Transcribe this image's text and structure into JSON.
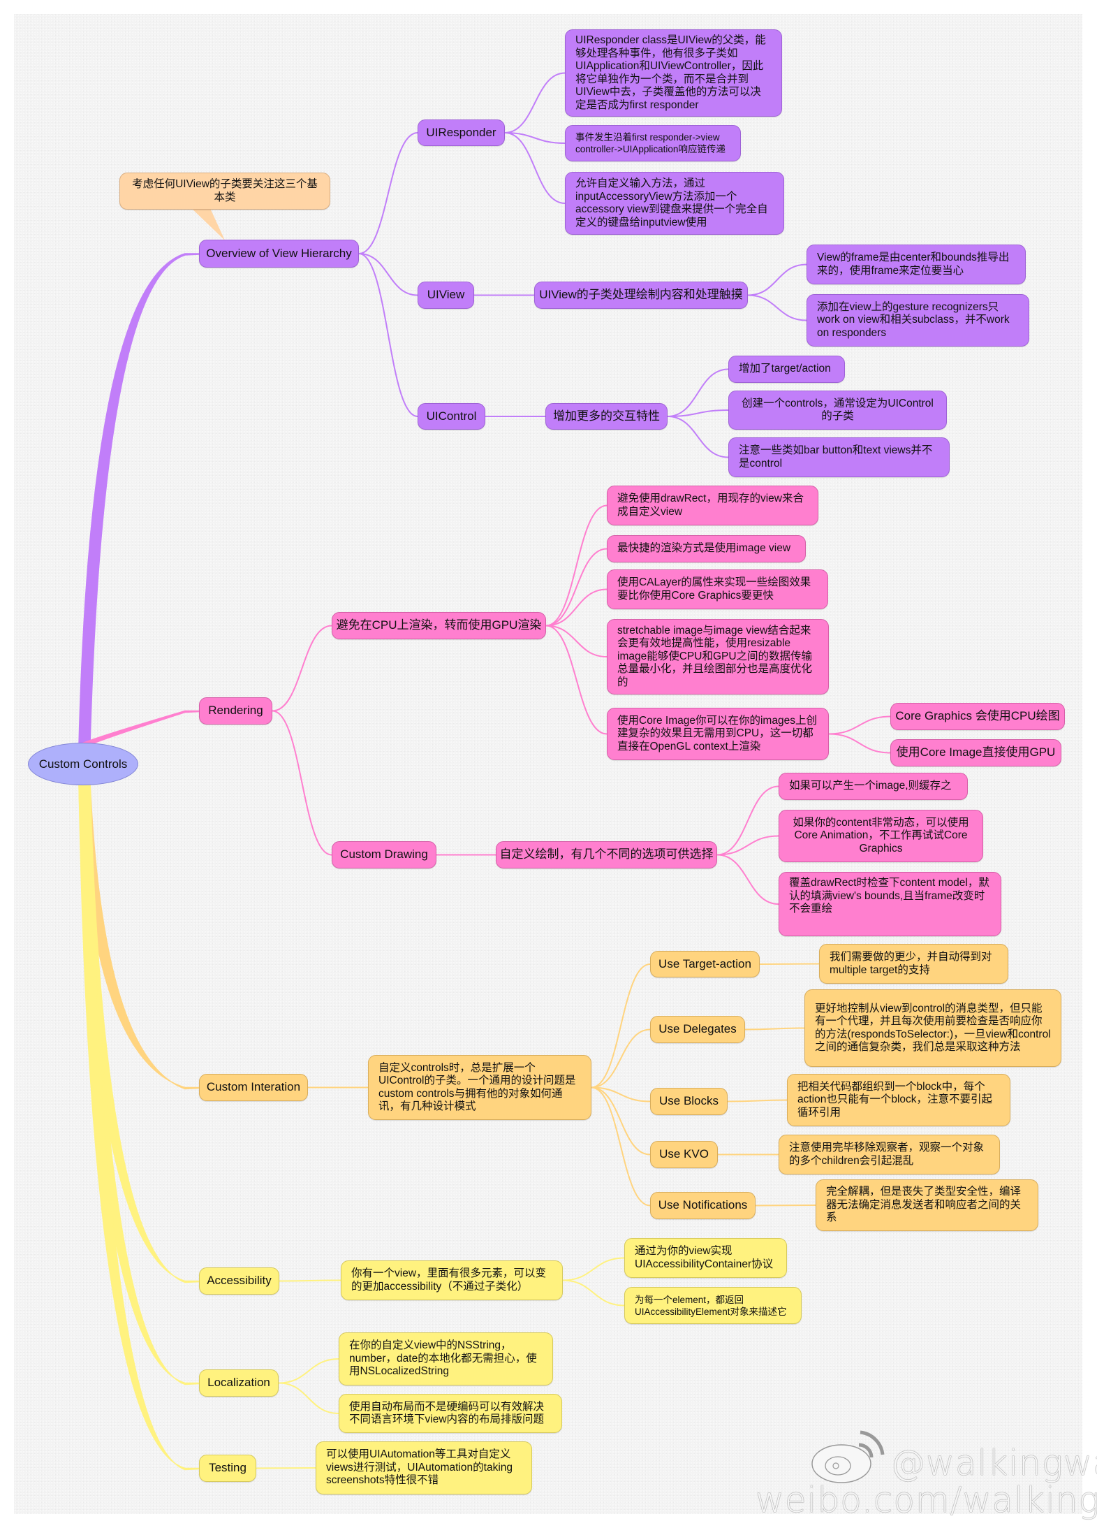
{
  "root": {
    "label": "Custom Controls"
  },
  "colors": {
    "view_hierarchy": "#c17ef9",
    "rendering": "#ff7fcf",
    "interaction": "#ffd47f",
    "accessibility_localization_testing": "#fff27f",
    "callout": "#ffd5a6",
    "root": "#aeb0fb"
  },
  "callout": {
    "text": "考虑任何UIView的子类要关注这三个基本类"
  },
  "branches": {
    "overview": {
      "label": "Overview of View Hierarchy",
      "uiresponder": {
        "label": "UIResponder",
        "notes": [
          "UIResponder class是UIView的父类，能够处理各种事件，他有很多子类如UIApplication和UIViewController，因此将它单独作为一个类，而不是合并到UIView中去，子类覆盖他的方法可以决定是否成为first responder",
          "事件发生沿着first responder->view controller->UIApplication响应链传递",
          "允许自定义输入方法，通过inputAccessoryView方法添加一个accessory view到键盘来提供一个完全自定义的键盘给inputview使用"
        ]
      },
      "uiview": {
        "label": "UIView",
        "desc": "UIView的子类处理绘制内容和处理触摸",
        "notes": [
          "View的frame是由center和bounds推导出来的，使用frame来定位要当心",
          "添加在view上的gesture recognizers只work on view和相关subclass，并不work on responders"
        ]
      },
      "uicontrol": {
        "label": "UIControl",
        "desc": "增加更多的交互特性",
        "notes": [
          "增加了target/action",
          "创建一个controls，通常设定为UIControl的子类",
          "注意一些类如bar button和text views并不是control"
        ]
      }
    },
    "rendering": {
      "label": "Rendering",
      "gpu": {
        "label": "避免在CPU上渲染，转而使用GPU渲染",
        "notes": [
          "避免使用drawRect，用现存的view来合成自定义view",
          "最快捷的渲染方式是使用image view",
          "使用CALayer的属性来实现一些绘图效果要比你使用Core Graphics要更快",
          "stretchable image与image view结合起来会更有效地提高性能，使用resizable image能够使CPU和GPU之间的数据传输总量最小化，并且绘图部分也是高度优化的",
          "使用Core Image你可以在你的images上创建复杂的效果且无需用到CPU，这一切都直接在OpenGL context上渲染"
        ],
        "core_image_notes": [
          "Core Graphics 会使用CPU绘图",
          "使用Core Image直接使用GPU"
        ]
      },
      "custom_drawing": {
        "label": "Custom Drawing",
        "desc": "自定义绘制，有几个不同的选项可供选择",
        "notes": [
          "如果可以产生一个image,则缓存之",
          "如果你的content非常动态，可以使用Core Animation，不工作再试试Core Graphics",
          "覆盖drawRect时检查下content model，默认的填满view's bounds,且当frame改变时不会重绘"
        ]
      }
    },
    "interaction": {
      "label": "Custom Interation",
      "desc": "自定义controls时，总是扩展一个UIControl的子类。一个通用的设计问题是custom controls与拥有他的对象如何通讯，有几种设计模式",
      "patterns": [
        {
          "label": "Use Target-action",
          "note": "我们需要做的更少，并自动得到对multiple target的支持"
        },
        {
          "label": "Use Delegates",
          "note": "更好地控制从view到control的消息类型，但只能有一个代理，并且每次使用前要检查是否响应你的方法(respondsToSelector:)，一旦view和control之间的通信复杂类，我们总是采取这种方法"
        },
        {
          "label": "Use Blocks",
          "note": "把相关代码都组织到一个block中，每个action也只能有一个block，注意不要引起循环引用"
        },
        {
          "label": "Use KVO",
          "note": "注意使用完毕移除观察者，观察一个对象的多个children会引起混乱"
        },
        {
          "label": "Use Notifications",
          "note": "完全解耦，但是丧失了类型安全性，编译器无法确定消息发送者和响应者之间的关系"
        }
      ]
    },
    "accessibility": {
      "label": "Accessibility",
      "desc": "你有一个view，里面有很多元素，可以变的更加accessibility（不通过子类化）",
      "notes": [
        "通过为你的view实现UIAccessibilityContainer协议",
        "为每一个element，都返回UIAccessibilityElement对象来描述它"
      ]
    },
    "localization": {
      "label": "Localization",
      "notes": [
        "在你的自定义view中的NSString，number，date的本地化都无需担心，使用NSLocalizedString",
        "使用自动布局而不是硬编码可以有效解决不同语言环境下view内容的布局排版问题"
      ]
    },
    "testing": {
      "label": "Testing",
      "desc": "可以使用UIAutomation等工具对自定义views进行测试，UIAutomation的taking screenshots特性很不错"
    }
  },
  "watermark": {
    "icon": "weibo-logo-icon",
    "handle": "@walkingway",
    "url": "weibo.com/walkingway"
  }
}
